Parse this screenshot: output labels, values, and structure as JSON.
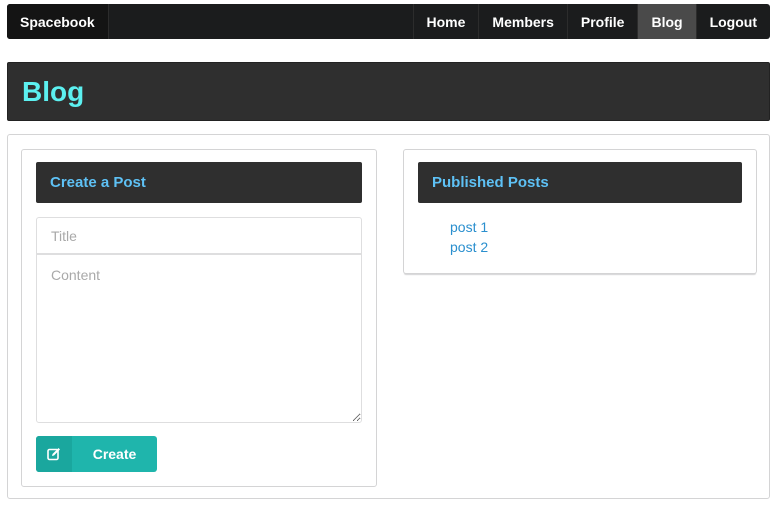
{
  "navbar": {
    "brand": "Spacebook",
    "items": [
      {
        "label": "Home",
        "active": false
      },
      {
        "label": "Members",
        "active": false
      },
      {
        "label": "Profile",
        "active": false
      },
      {
        "label": "Blog",
        "active": true
      },
      {
        "label": "Logout",
        "active": false
      }
    ]
  },
  "page": {
    "title": "Blog"
  },
  "create_post": {
    "header": "Create a Post",
    "title_field": {
      "value": "",
      "placeholder": "Title"
    },
    "content_field": {
      "value": "",
      "placeholder": "Content"
    },
    "button_label": "Create",
    "button_icon": "edit-icon"
  },
  "published_posts": {
    "header": "Published Posts",
    "posts": [
      "post 1",
      "post 2"
    ]
  },
  "colors": {
    "accent_cyan": "#5cf0f0",
    "header_blue": "#5ec1f5",
    "button_teal": "#1fb5ac",
    "link_blue": "#2a8fce",
    "dark_bar": "#2f2f2f"
  }
}
